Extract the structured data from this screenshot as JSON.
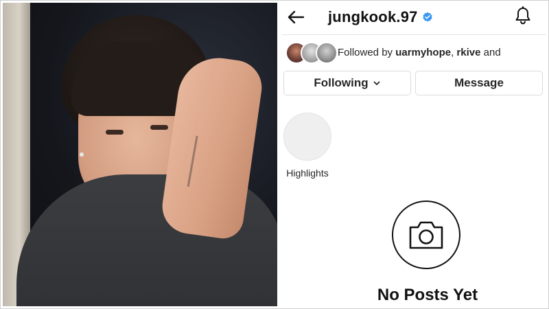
{
  "profile": {
    "username": "jungkook.97",
    "verified_icon": "verified-badge-icon",
    "accent": "#3897f0"
  },
  "followed_by": {
    "prefix": "Followed by ",
    "user1": "uarmyhope",
    "sep": ", ",
    "user2": "rkive",
    "suffix": " and"
  },
  "buttons": {
    "following_label": "Following",
    "message_label": "Message"
  },
  "highlights": {
    "label": "Highlights"
  },
  "posts": {
    "empty_label": "No Posts Yet"
  },
  "icons": {
    "back": "back-arrow-icon",
    "bell": "bell-icon",
    "chevron": "chevron-down-icon",
    "camera": "camera-icon"
  }
}
